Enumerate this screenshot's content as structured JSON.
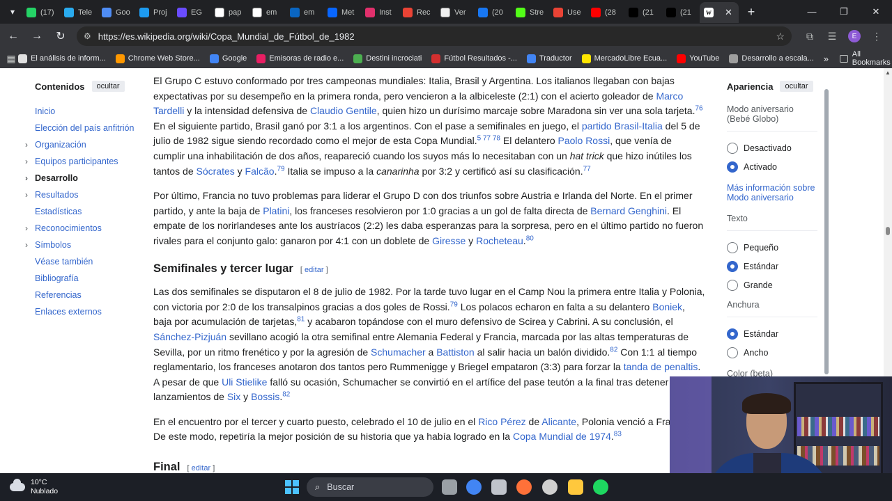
{
  "browser": {
    "tabs": [
      {
        "label": "(17)",
        "icon": "whatsapp-icon",
        "color": "#25d366"
      },
      {
        "label": "Tele",
        "icon": "telegram-icon",
        "color": "#2aabee"
      },
      {
        "label": "Goo",
        "icon": "gemini-icon",
        "color": "#4f8df5"
      },
      {
        "label": "Proj",
        "icon": "copilot-icon",
        "color": "#1d9bf0"
      },
      {
        "label": "EG",
        "icon": "shield-icon",
        "color": "#6a4cff"
      },
      {
        "label": "pap",
        "icon": "google-icon",
        "color": "#ffffff"
      },
      {
        "label": "em",
        "icon": "google-icon",
        "color": "#ffffff"
      },
      {
        "label": "em",
        "icon": "linkedin-icon",
        "color": "#0a66c2"
      },
      {
        "label": "Met",
        "icon": "meta-icon",
        "color": "#0866ff"
      },
      {
        "label": "Inst",
        "icon": "instagram-icon",
        "color": "#e1306c"
      },
      {
        "label": "Rec",
        "icon": "gmail-icon",
        "color": "#ea4335"
      },
      {
        "label": "Ver",
        "icon": "github-icon",
        "color": "#f0f0f0"
      },
      {
        "label": "(20",
        "icon": "facebook-icon",
        "color": "#1877f2"
      },
      {
        "label": "Stre",
        "icon": "kick-icon",
        "color": "#53fc18"
      },
      {
        "label": "Use",
        "icon": "gmail-icon",
        "color": "#ea4335"
      },
      {
        "label": "(28",
        "icon": "youtube-icon",
        "color": "#ff0000"
      },
      {
        "label": "(21",
        "icon": "x-icon",
        "color": "#000000"
      },
      {
        "label": "(21",
        "icon": "x-icon",
        "color": "#000000"
      }
    ],
    "active_tab_icon": "W",
    "url": "https://es.wikipedia.org/wiki/Copa_Mundial_de_Fútbol_de_1982",
    "profile_letter": "E",
    "bookmarks": [
      {
        "label": "El análisis de inform...",
        "color": "#e0e0e0"
      },
      {
        "label": "Chrome Web Store...",
        "color": "#ff9800"
      },
      {
        "label": "Google",
        "color": "#4285f4"
      },
      {
        "label": "Emisoras de radio e...",
        "color": "#e91e63"
      },
      {
        "label": "Destini incrociati",
        "color": "#4caf50"
      },
      {
        "label": "Fútbol Resultados -...",
        "color": "#d32f2f"
      },
      {
        "label": "Traductor",
        "color": "#4285f4"
      },
      {
        "label": "MercadoLibre Ecua...",
        "color": "#ffe600"
      },
      {
        "label": "YouTube",
        "color": "#ff0000"
      },
      {
        "label": "Desarrollo a escala...",
        "color": "#9e9e9e"
      }
    ],
    "all_bookmarks": "All Bookmarks"
  },
  "toc": {
    "title": "Contenidos",
    "hide": "ocultar",
    "items": [
      {
        "label": "Inicio",
        "expandable": false
      },
      {
        "label": "Elección del país anfitrión",
        "expandable": false
      },
      {
        "label": "Organización",
        "expandable": true
      },
      {
        "label": "Equipos participantes",
        "expandable": true
      },
      {
        "label": "Desarrollo",
        "expandable": true
      },
      {
        "label": "Resultados",
        "expandable": true
      },
      {
        "label": "Estadísticas",
        "expandable": false
      },
      {
        "label": "Reconocimientos",
        "expandable": true
      },
      {
        "label": "Símbolos",
        "expandable": true
      },
      {
        "label": "Véase también",
        "expandable": false
      },
      {
        "label": "Bibliografía",
        "expandable": false
      },
      {
        "label": "Referencias",
        "expandable": false
      },
      {
        "label": "Enlaces externos",
        "expandable": false
      }
    ]
  },
  "article": {
    "p1": [
      {
        "t": "El Grupo C estuvo conformado por tres campeonas mundiales: Italia, Brasil y Argentina. Los italianos llegaban con bajas expectativas por su desempeño en la primera ronda, pero vencieron a la albiceleste (2:1) con el acierto goleador de "
      },
      {
        "t": "Marco Tardelli",
        "k": "link"
      },
      {
        "t": " y la intensidad defensiva de "
      },
      {
        "t": "Claudio Gentile",
        "k": "link"
      },
      {
        "t": ", quien hizo un durísimo marcaje sobre Maradona sin ver una sola tarjeta."
      },
      {
        "t": "76",
        "k": "sup"
      },
      {
        "t": " En el siguiente partido, Brasil ganó por 3:1 a los argentinos. Con el pase a semifinales en juego, el "
      },
      {
        "t": "partido Brasil-Italia",
        "k": "link"
      },
      {
        "t": " del 5 de julio de 1982 sigue siendo recordado como el mejor de esta Copa Mundial."
      },
      {
        "t": "5 77 78",
        "k": "sup"
      },
      {
        "t": " El delantero "
      },
      {
        "t": "Paolo Rossi",
        "k": "link"
      },
      {
        "t": ", que venía de cumplir una inhabilitación de dos años, reapareció cuando los suyos más lo necesitaban con un "
      },
      {
        "t": "hat trick",
        "k": "ital"
      },
      {
        "t": " que hizo inútiles los tantos de "
      },
      {
        "t": "Sócrates",
        "k": "link"
      },
      {
        "t": " y "
      },
      {
        "t": "Falcão",
        "k": "link"
      },
      {
        "t": "."
      },
      {
        "t": "79",
        "k": "sup"
      },
      {
        "t": " Italia se impuso a la "
      },
      {
        "t": "canarinha",
        "k": "ital"
      },
      {
        "t": " por 3:2 y certificó así su clasificación."
      },
      {
        "t": "77",
        "k": "sup"
      }
    ],
    "p2": [
      {
        "t": "Por último, Francia no tuvo problemas para liderar el Grupo D con dos triunfos sobre Austria e Irlanda del Norte. En el primer partido, y ante la baja de "
      },
      {
        "t": "Platini",
        "k": "link"
      },
      {
        "t": ", los franceses resolvieron por 1:0 gracias a un gol de falta directa de "
      },
      {
        "t": "Bernard Genghini",
        "k": "link"
      },
      {
        "t": ". El empate de los norirlandeses ante los austríacos (2:2) les daba esperanzas para la sorpresa, pero en el último partido no fueron rivales para el conjunto galo: ganaron por 4:1 con un doblete de "
      },
      {
        "t": "Giresse",
        "k": "link"
      },
      {
        "t": " y "
      },
      {
        "t": "Rocheteau",
        "k": "link"
      },
      {
        "t": "."
      },
      {
        "t": "80",
        "k": "sup"
      }
    ],
    "h_semis": "Semifinales y tercer lugar",
    "edit_open": "[ ",
    "edit_label": "editar",
    "edit_close": " ]",
    "p3": [
      {
        "t": "Las dos semifinales se disputaron el 8 de julio de 1982. Por la tarde tuvo lugar en el Camp Nou la primera entre Italia y Polonia, con victoria por 2:0 de los transalpinos gracias a dos goles de Rossi."
      },
      {
        "t": "79",
        "k": "sup"
      },
      {
        "t": " Los polacos echaron en falta a su delantero "
      },
      {
        "t": "Boniek",
        "k": "link"
      },
      {
        "t": ", baja por acumulación de tarjetas,"
      },
      {
        "t": "81",
        "k": "sup"
      },
      {
        "t": " y acabaron topándose con el muro defensivo de Scirea y Cabrini. A su conclusión, el "
      },
      {
        "t": "Sánchez-Pizjuán",
        "k": "link"
      },
      {
        "t": " sevillano acogió la otra semifinal entre Alemania Federal y Francia, marcada por las altas temperaturas de Sevilla, por un ritmo frenético y por la agresión de "
      },
      {
        "t": "Schumacher",
        "k": "link"
      },
      {
        "t": " a "
      },
      {
        "t": "Battiston",
        "k": "link"
      },
      {
        "t": " al salir hacia un balón dividido."
      },
      {
        "t": "82",
        "k": "sup"
      },
      {
        "t": " Con 1:1 al tiempo reglamentario, los franceses anotaron dos tantos pero Rummenigge y Briegel empataron (3:3) para forzar la "
      },
      {
        "t": "tanda de penaltis",
        "k": "link"
      },
      {
        "t": ". A pesar de que "
      },
      {
        "t": "Uli Stielike",
        "k": "link"
      },
      {
        "t": " falló su ocasión, Schumacher se convirtió en el artífice del pase teutón a la final tras detener los lanzamientos de "
      },
      {
        "t": "Six",
        "k": "link"
      },
      {
        "t": " y "
      },
      {
        "t": "Bossis",
        "k": "link"
      },
      {
        "t": "."
      },
      {
        "t": "82",
        "k": "sup"
      }
    ],
    "p4": [
      {
        "t": "En el encuentro por el tercer y cuarto puesto, celebrado el 10 de julio en el "
      },
      {
        "t": "Rico Pérez",
        "k": "link"
      },
      {
        "t": " de "
      },
      {
        "t": "Alicante",
        "k": "link"
      },
      {
        "t": ", Polonia venció a Francia p"
      },
      {
        "t": " De este modo, repetiría la mejor posición de su historia que ya había logrado en la "
      },
      {
        "t": "Copa Mundial de 1974",
        "k": "link"
      },
      {
        "t": "."
      },
      {
        "t": "83",
        "k": "sup"
      }
    ],
    "h_final": "Final"
  },
  "appearance": {
    "title": "Apariencia",
    "hide": "ocultar",
    "anniversary_label": "Modo aniversario (Bebé Globo)",
    "anniversary_options": [
      {
        "label": "Desactivado",
        "selected": false
      },
      {
        "label": "Activado",
        "selected": true
      }
    ],
    "more_info": "Más información sobre Modo aniversario",
    "text_label": "Texto",
    "text_options": [
      {
        "label": "Pequeño",
        "selected": false
      },
      {
        "label": "Estándar",
        "selected": true
      },
      {
        "label": "Grande",
        "selected": false
      }
    ],
    "width_label": "Anchura",
    "width_options": [
      {
        "label": "Estándar",
        "selected": true
      },
      {
        "label": "Ancho",
        "selected": false
      }
    ],
    "color_label": "Color (beta)"
  },
  "taskbar": {
    "temp": "10°C",
    "weather": "Nublado",
    "search": "Buscar",
    "apps": [
      {
        "icon": "task-view-icon",
        "color": "#9aa0a6"
      },
      {
        "icon": "chrome-icon",
        "color": "#4285f4"
      },
      {
        "icon": "app-cube-icon",
        "color": "#c0c4cc"
      },
      {
        "icon": "firefox-icon",
        "color": "#ff7139"
      },
      {
        "icon": "obs-icon",
        "color": "#d0d0d0"
      },
      {
        "icon": "file-explorer-icon",
        "color": "#ffc83d"
      },
      {
        "icon": "spotify-icon",
        "color": "#1ed760"
      }
    ]
  }
}
